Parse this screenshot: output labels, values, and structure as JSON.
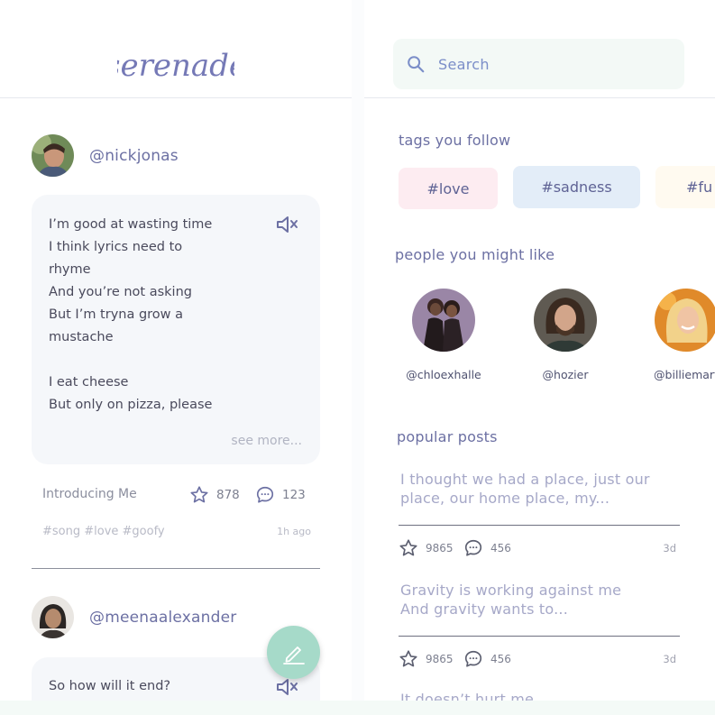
{
  "app": {
    "logo_text": "serenade"
  },
  "feed": {
    "posts": [
      {
        "username": "@nickjonas",
        "lyrics": "I’m good at wasting time\nI think lyrics need to\nrhyme\nAnd you’re not asking\nBut I’m tryna grow a\nmustache\n\nI eat cheese\nBut only on pizza, please",
        "see_more": "see more...",
        "song_title": "Introducing Me",
        "stars": "878",
        "comments": "123",
        "tags": "#song #love #goofy",
        "time": "1h ago"
      },
      {
        "username": "@meenaalexander",
        "lyrics": "So how will it end?"
      }
    ]
  },
  "explore": {
    "search": {
      "placeholder": "Search"
    },
    "tags_title": "tags you follow",
    "tags": [
      {
        "label": "#love",
        "color": "#fdecf1"
      },
      {
        "label": "#sadness",
        "color": "#e3edf8"
      },
      {
        "label": "#fu",
        "color": "#fffaf0"
      }
    ],
    "people_title": "people you might like",
    "people": [
      {
        "handle": "@chloexhalle"
      },
      {
        "handle": "@hozier"
      },
      {
        "handle": "@billiemart"
      }
    ],
    "popular_title": "popular posts",
    "popular_posts": [
      {
        "text": "I thought we had a place, just our place, our home place, my...",
        "stars": "9865",
        "comments": "456",
        "time": "3d"
      },
      {
        "text": "Gravity is working against me\nAnd gravity wants to...",
        "stars": "9865",
        "comments": "456",
        "time": "3d"
      },
      {
        "text": "It doesn’t hurt me"
      }
    ]
  },
  "colors": {
    "accent": "#6c70a3",
    "fab": "#a6dac9",
    "search_bg": "#f3f9f6"
  }
}
